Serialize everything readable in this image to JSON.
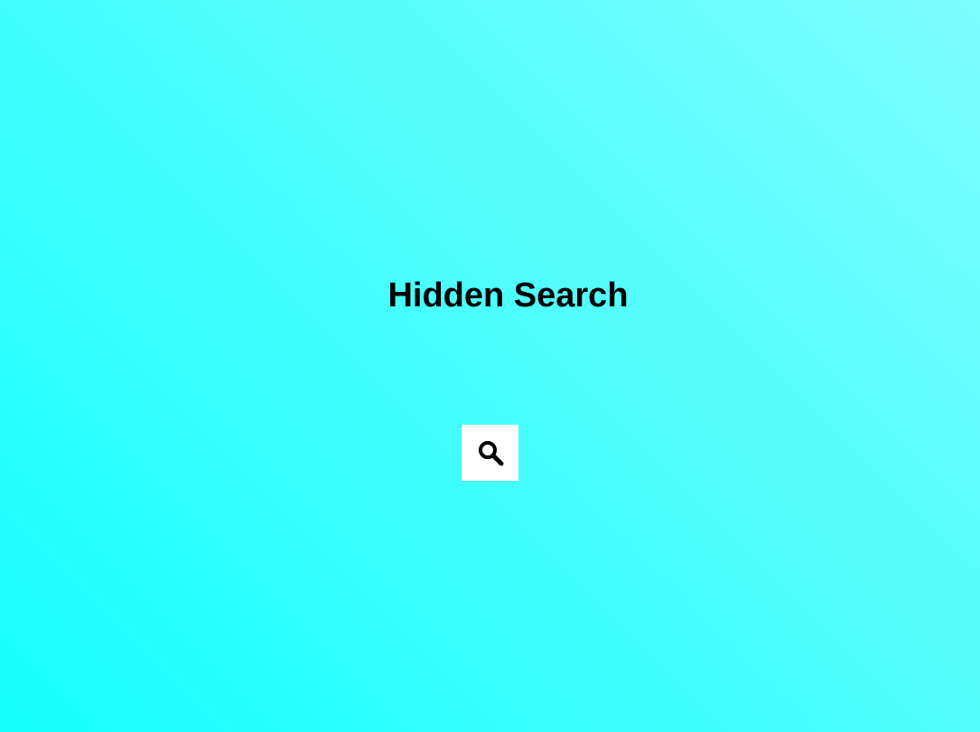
{
  "page": {
    "title": "Hidden Search"
  },
  "search": {
    "icon": "search-icon"
  },
  "colors": {
    "background_start": "#15fffe",
    "background_end": "#7dfdfe",
    "text": "#000000",
    "button_background": "#ffffff"
  }
}
